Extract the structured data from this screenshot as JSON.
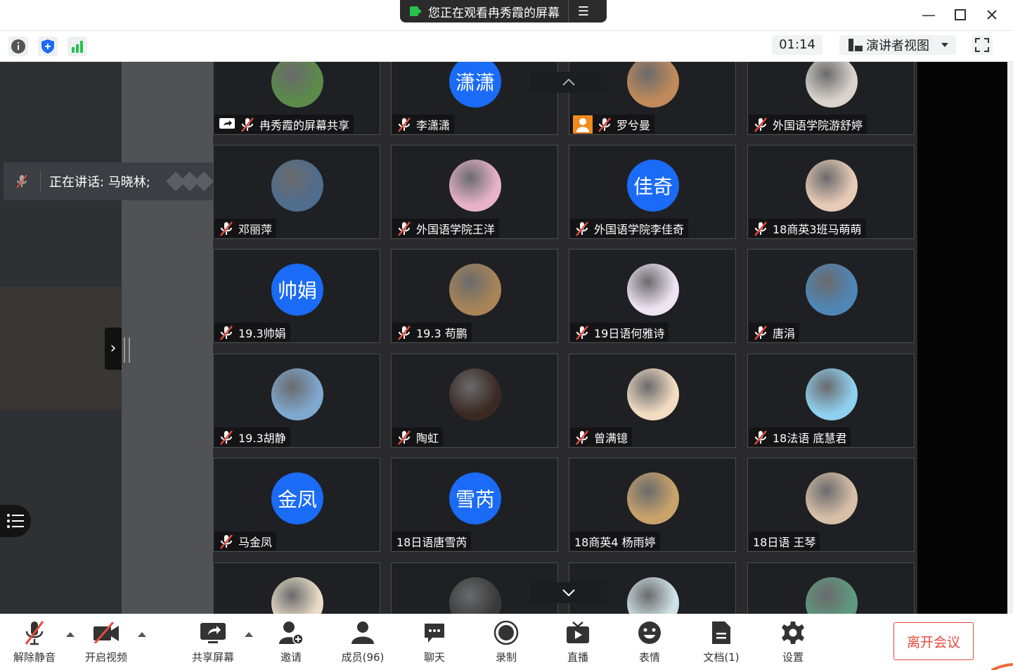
{
  "banner": {
    "text": "您正在观看冉秀霞的屏幕",
    "menu_icon": "menu-lines-icon"
  },
  "window_controls": [
    "minimize-icon",
    "maximize-icon",
    "close-icon"
  ],
  "toolbar": {
    "timer": "01:14",
    "view_label": "演讲者视图"
  },
  "speaking": {
    "text": "正在讲话: 马晓林;"
  },
  "participants": [
    {
      "name": "冉秀霞的屏幕共享",
      "avatar_kind": "photo",
      "avatar_color": "#5b8a4a",
      "screen_share": true,
      "muted": true
    },
    {
      "name": "李潇潇",
      "avatar_kind": "text",
      "avatar_text": "潇潇",
      "muted": true
    },
    {
      "name": "罗兮曼",
      "avatar_kind": "photo",
      "avatar_color": "#c08a5a",
      "host": true,
      "muted": true
    },
    {
      "name": "外国语学院游舒婷",
      "avatar_kind": "photo",
      "avatar_color": "#d9d3cc",
      "muted": true
    },
    {
      "name": "邓丽萍",
      "avatar_kind": "photo",
      "avatar_color": "#4f6d8c",
      "muted": true
    },
    {
      "name": "外国语学院王洋",
      "avatar_kind": "photo",
      "avatar_color": "#e7b3c6",
      "muted": true
    },
    {
      "name": "外国语学院李佳奇",
      "avatar_kind": "text",
      "avatar_text": "佳奇",
      "muted": true
    },
    {
      "name": "18商英3班马萌萌",
      "avatar_kind": "photo",
      "avatar_color": "#e8cbb6",
      "muted": true
    },
    {
      "name": "19.3帅娟",
      "avatar_kind": "text",
      "avatar_text": "帅娟",
      "muted": true
    },
    {
      "name": "19.3 苟鹏",
      "avatar_kind": "photo",
      "avatar_color": "#a88457",
      "muted": true
    },
    {
      "name": "19日语何雅诗",
      "avatar_kind": "photo",
      "avatar_color": "#efe4f2",
      "muted": true
    },
    {
      "name": "唐涓",
      "avatar_kind": "photo",
      "avatar_color": "#4f86b6",
      "muted": true
    },
    {
      "name": "19.3胡静",
      "avatar_kind": "photo",
      "avatar_color": "#7fa8cf",
      "muted": true
    },
    {
      "name": "陶虹",
      "avatar_kind": "photo",
      "avatar_color": "#3b2a24",
      "muted": true
    },
    {
      "name": "曾满镱",
      "avatar_kind": "photo",
      "avatar_color": "#f2dcc2",
      "muted": true
    },
    {
      "name": "18法语 底慧君",
      "avatar_kind": "photo",
      "avatar_color": "#8fd0ef",
      "muted": true
    },
    {
      "name": "马金凤",
      "avatar_kind": "text",
      "avatar_text": "金凤",
      "muted": true
    },
    {
      "name": "18日语唐雪芮",
      "avatar_kind": "text",
      "avatar_text": "雪芮",
      "muted": false
    },
    {
      "name": "18商英4 杨雨婷",
      "avatar_kind": "photo",
      "avatar_color": "#c9a36a",
      "muted": false
    },
    {
      "name": "18日语 王琴",
      "avatar_kind": "photo",
      "avatar_color": "#d8c0a8",
      "muted": false
    },
    {
      "name": "",
      "avatar_kind": "photo",
      "avatar_color": "#e9dcc6",
      "muted": false
    },
    {
      "name": "",
      "avatar_kind": "photo",
      "avatar_color": "#3a3a3a",
      "muted": false
    },
    {
      "name": "",
      "avatar_kind": "photo",
      "avatar_color": "#cfe3e6",
      "muted": false
    },
    {
      "name": "",
      "avatar_kind": "photo",
      "avatar_color": "#5f9a80",
      "muted": false
    }
  ],
  "bottom": {
    "unmute": "解除静音",
    "video": "开启视频",
    "share": "共享屏幕",
    "invite": "邀请",
    "members": "成员(96)",
    "chat": "聊天",
    "record": "录制",
    "live": "直播",
    "emoji": "表情",
    "docs": "文档(1)",
    "settings": "设置",
    "leave": "离开会议"
  },
  "colors": {
    "accent_blue": "#1a6bf5",
    "leave_red": "#e5483c",
    "signal_green": "#27c24c"
  }
}
